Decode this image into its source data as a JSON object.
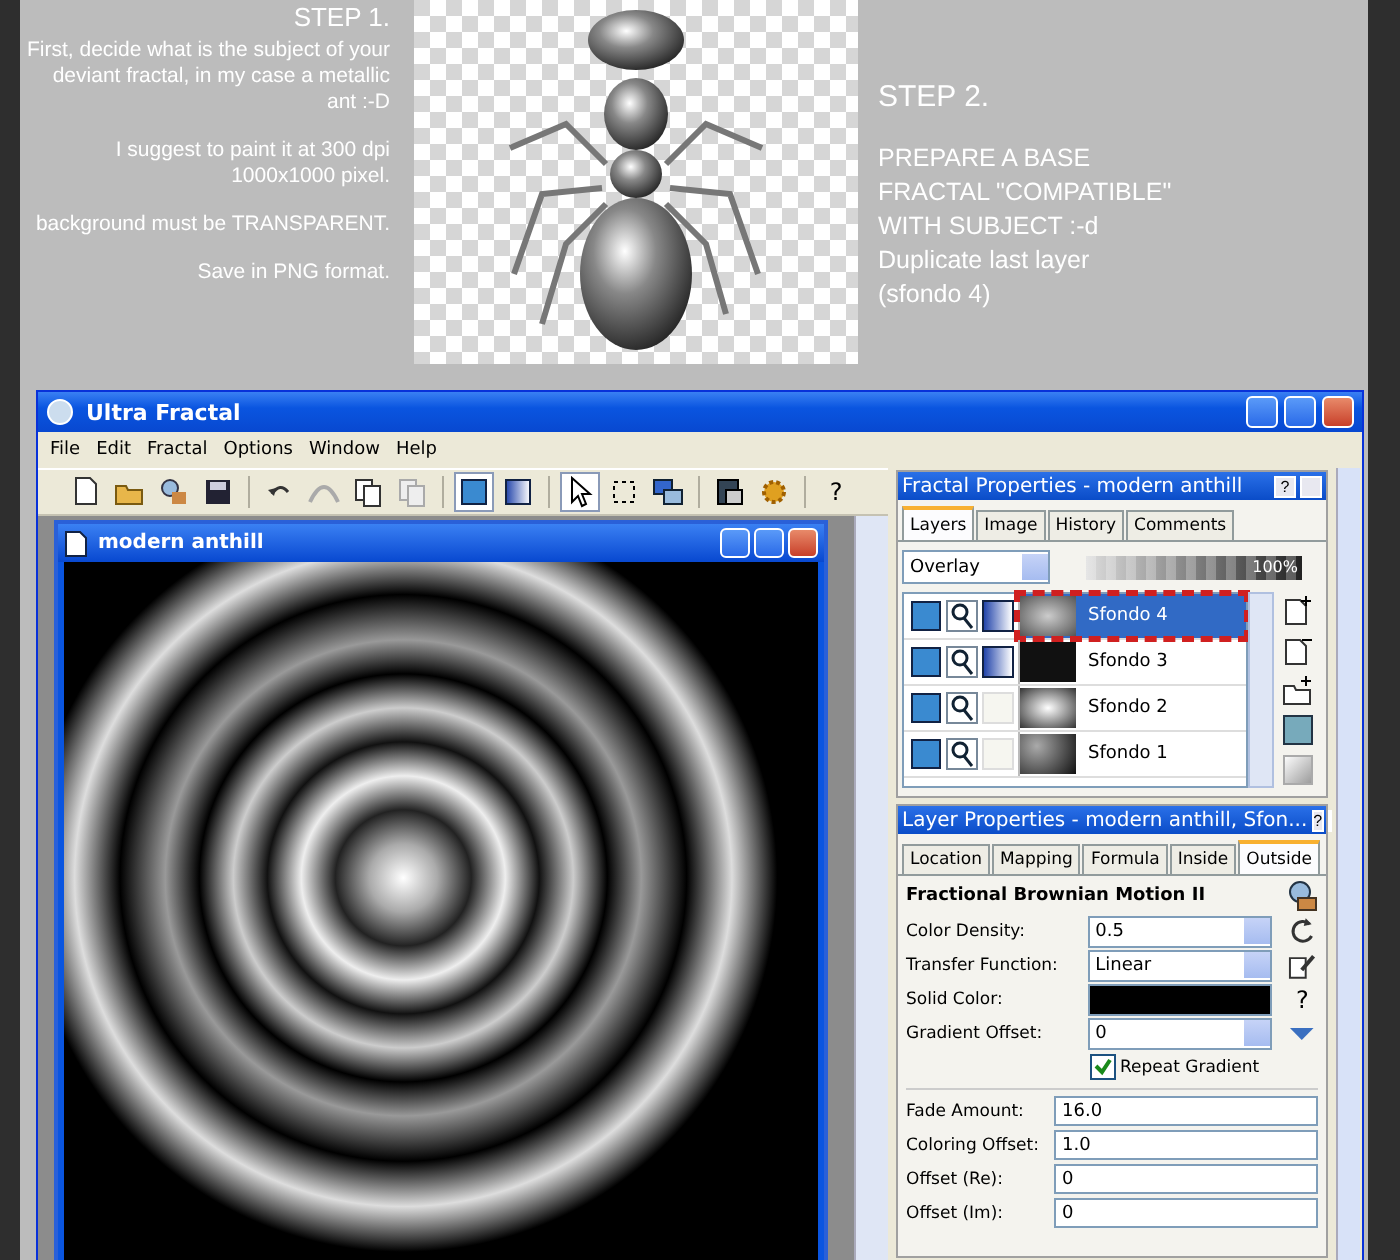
{
  "step1": {
    "heading": "STEP 1.",
    "paragraphs": [
      "First, decide what is the subject of your deviant fractal, in my case a metallic ant :-D",
      "I suggest to paint it at 300 dpi 1000x1000 pixel.",
      "background must be TRANSPARENT.",
      "Save in PNG format."
    ]
  },
  "step2": {
    "heading": "STEP 2.",
    "paragraphs": [
      "PREPARE A BASE FRACTAL \"COMPATIBLE\" WITH SUBJECT :-d",
      "Duplicate last layer (sfondo 4)"
    ]
  },
  "window": {
    "title": "Ultra Fractal"
  },
  "menu": [
    "File",
    "Edit",
    "Fractal",
    "Options",
    "Window",
    "Help"
  ],
  "toolbar": [
    {
      "kind": "new"
    },
    {
      "kind": "open"
    },
    {
      "kind": "browse"
    },
    {
      "kind": "save"
    },
    {
      "kind": "sep"
    },
    {
      "kind": "undo"
    },
    {
      "kind": "redo"
    },
    {
      "kind": "copy"
    },
    {
      "kind": "paste"
    },
    {
      "kind": "sep"
    },
    {
      "kind": "view",
      "selected": true
    },
    {
      "kind": "gradient",
      "selected": false
    },
    {
      "kind": "sep"
    },
    {
      "kind": "pointer",
      "selected": true
    },
    {
      "kind": "select",
      "selected": false
    },
    {
      "kind": "windows",
      "selected": false
    },
    {
      "kind": "sep"
    },
    {
      "kind": "render"
    },
    {
      "kind": "gear"
    },
    {
      "kind": "sep"
    },
    {
      "kind": "help",
      "text": "?"
    }
  ],
  "document": {
    "title": "modern anthill"
  },
  "fractal_properties": {
    "title": "Fractal Properties - modern anthill",
    "help_text": "?",
    "tabs": [
      {
        "label": "Layers",
        "selected": true
      },
      {
        "label": "Image",
        "selected": false
      },
      {
        "label": "History",
        "selected": false
      },
      {
        "label": "Comments",
        "selected": false
      }
    ],
    "merge_mode": "Overlay",
    "opacity": {
      "reading": "100%",
      "level": 1.0
    },
    "layers": [
      {
        "name": "Sfondo 4",
        "selected": true,
        "highlighted": true,
        "gradient": true
      },
      {
        "name": "Sfondo 3",
        "selected": false,
        "highlighted": false,
        "gradient": true
      },
      {
        "name": "Sfondo 2",
        "selected": false,
        "highlighted": false,
        "gradient": false
      },
      {
        "name": "Sfondo 1",
        "selected": false,
        "highlighted": false,
        "gradient": false
      }
    ]
  },
  "layer_properties": {
    "title": "Layer Properties - modern anthill, Sfon...",
    "help_text": "?",
    "tabs": [
      {
        "label": "Location",
        "selected": false
      },
      {
        "label": "Mapping",
        "selected": false
      },
      {
        "label": "Formula",
        "selected": false
      },
      {
        "label": "Inside",
        "selected": false
      },
      {
        "label": "Outside",
        "selected": true
      }
    ],
    "formula": "Fractional Brownian Motion II",
    "params": [
      {
        "kind": "dropdown",
        "label": "Color Density:",
        "value": "0.5"
      },
      {
        "kind": "dropdown",
        "label": "Transfer Function:",
        "value": "Linear"
      },
      {
        "kind": "color",
        "label": "Solid Color:",
        "color": "#000000"
      },
      {
        "kind": "dropdown",
        "label": "Gradient Offset:",
        "value": "0"
      },
      {
        "kind": "checkbox",
        "label": "Repeat Gradient",
        "checked": true
      }
    ],
    "param_tools": [
      {
        "kind": "reset"
      },
      {
        "kind": "edit"
      },
      {
        "kind": "help",
        "text": "?"
      },
      {
        "kind": "triangle"
      }
    ],
    "fields": [
      {
        "label": "Fade Amount:",
        "value": "16.0"
      },
      {
        "label": "Coloring Offset:",
        "value": "1.0"
      },
      {
        "label": "Offset (Re):",
        "value": "0"
      },
      {
        "label": "Offset (Im):",
        "value": "0"
      }
    ]
  }
}
